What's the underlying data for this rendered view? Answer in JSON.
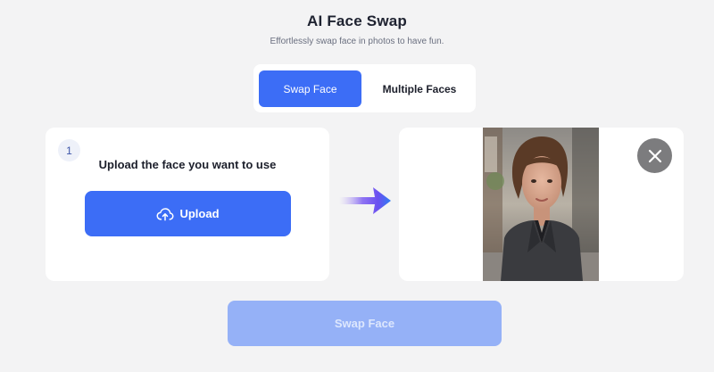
{
  "header": {
    "title": "AI Face Swap",
    "subtitle": "Effortlessly swap face in photos to have fun."
  },
  "tabs": [
    {
      "label": "Swap Face",
      "active": true
    },
    {
      "label": "Multiple Faces",
      "active": false
    }
  ],
  "upload_card": {
    "step_number": "1",
    "heading": "Upload the face you want to use",
    "upload_label": "Upload",
    "upload_icon": "cloud-upload-icon"
  },
  "target_card": {
    "image_alt": "Portrait of a woman on a city street",
    "close_icon": "close-icon"
  },
  "action": {
    "swap_label": "Swap Face",
    "enabled": false
  },
  "colors": {
    "accent": "#3c6df6",
    "accent_disabled": "#95b1f7",
    "background": "#f3f3f4",
    "card": "#ffffff"
  }
}
